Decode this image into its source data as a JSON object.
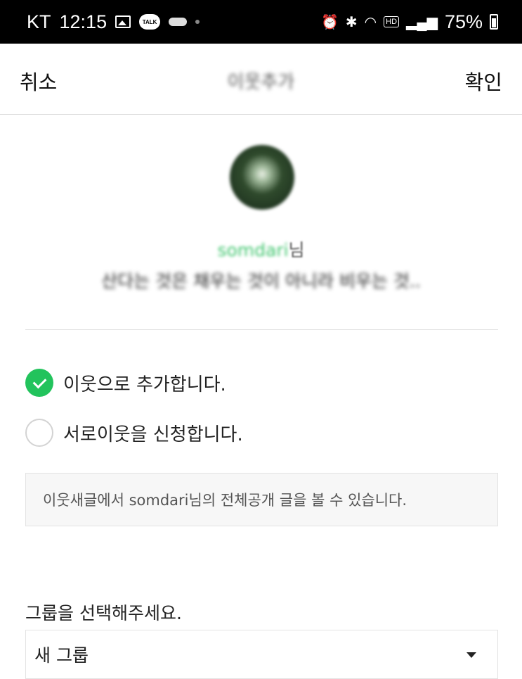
{
  "status_bar": {
    "carrier": "KT",
    "time": "12:15",
    "talk_badge": "TALK",
    "battery": "75%"
  },
  "header": {
    "cancel_label": "취소",
    "title": "이웃추가",
    "confirm_label": "확인"
  },
  "profile": {
    "nickname": "somdari",
    "nickname_suffix": "님",
    "bio": "산다는 것은 채우는 것이 아니라 비우는 것.."
  },
  "options": [
    {
      "label": "이웃으로 추가합니다.",
      "checked": true
    },
    {
      "label": "서로이웃을 신청합니다.",
      "checked": false
    }
  ],
  "info_text": "이웃새글에서 somdari님의 전체공개 글을 볼 수 있습니다.",
  "group": {
    "label": "그룹을 선택해주세요.",
    "selected": "새 그룹"
  },
  "colors": {
    "accent": "#22c35c",
    "nickname": "#41c66f",
    "status_bar": "#000000"
  }
}
